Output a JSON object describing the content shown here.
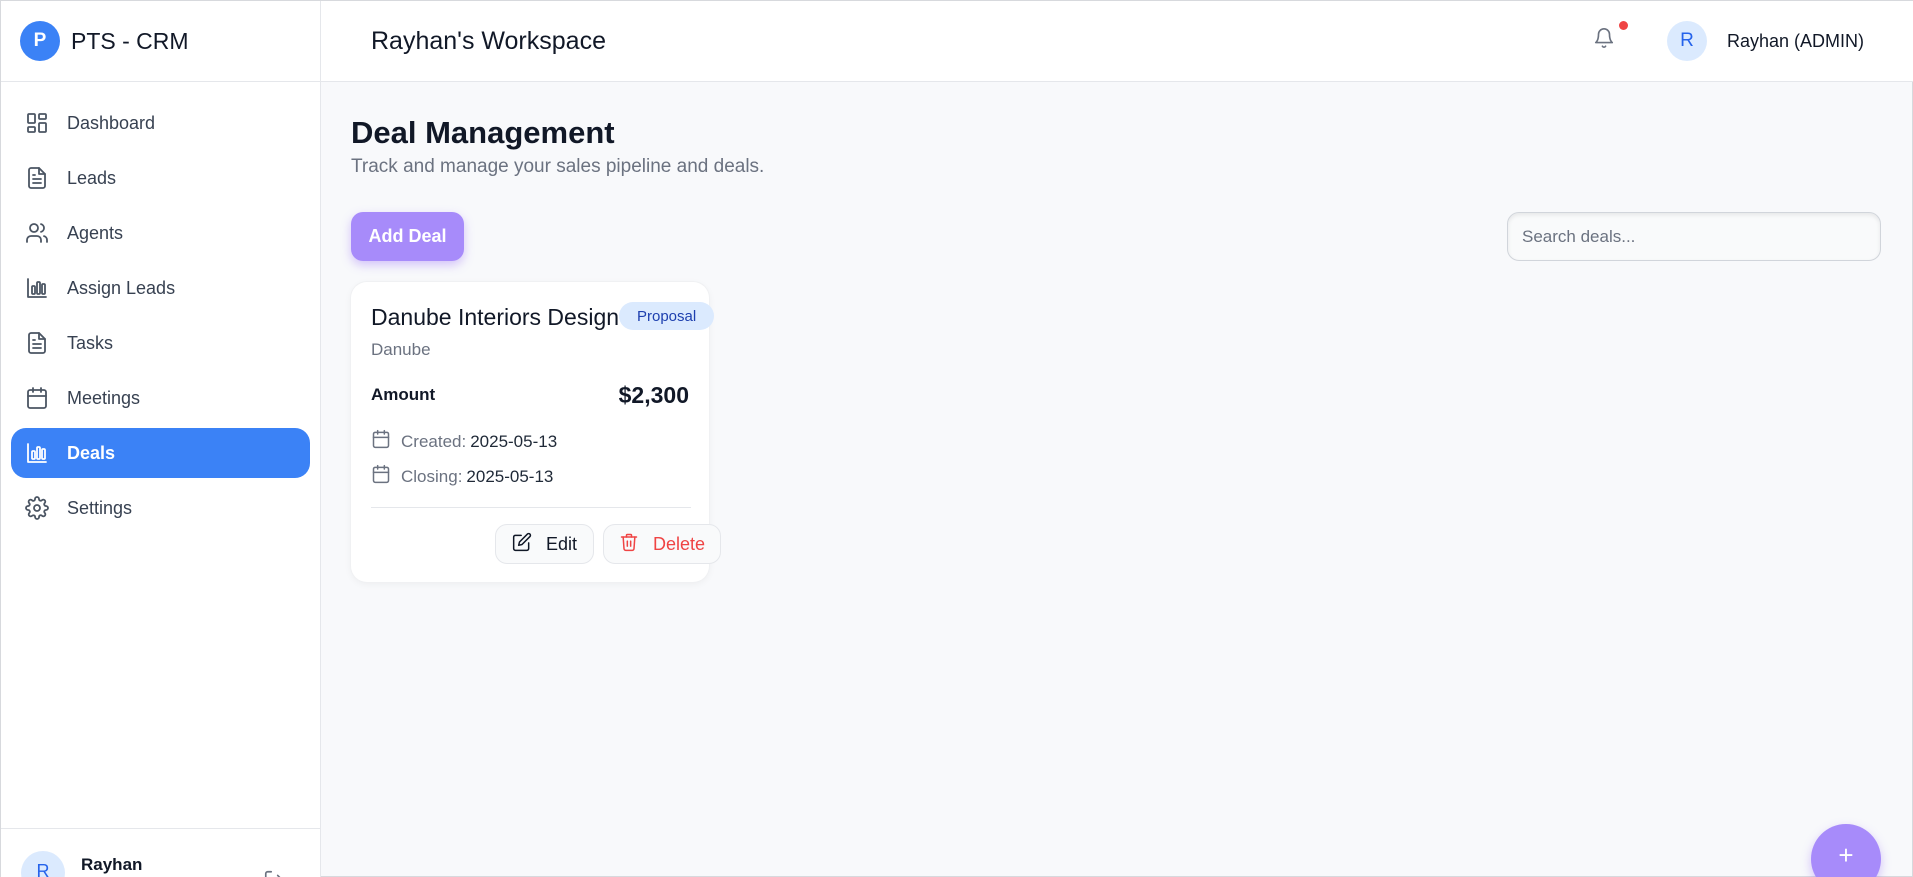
{
  "brand": {
    "logo_letter": "P",
    "name": "PTS - CRM"
  },
  "sidebar": {
    "items": [
      {
        "label": "Dashboard",
        "icon": "dashboard-icon"
      },
      {
        "label": "Leads",
        "icon": "document-icon"
      },
      {
        "label": "Agents",
        "icon": "users-icon"
      },
      {
        "label": "Assign Leads",
        "icon": "bar-chart-icon"
      },
      {
        "label": "Tasks",
        "icon": "document-icon"
      },
      {
        "label": "Meetings",
        "icon": "calendar-icon"
      },
      {
        "label": "Deals",
        "icon": "bar-chart-icon",
        "active": true
      },
      {
        "label": "Settings",
        "icon": "gear-icon"
      }
    ],
    "footer": {
      "avatar_letter": "R",
      "name": "Rayhan"
    }
  },
  "header": {
    "workspace_title": "Rayhan's Workspace",
    "user": {
      "avatar_letter": "R",
      "name": "Rayhan (ADMIN)"
    }
  },
  "page": {
    "title": "Deal Management",
    "subtitle": "Track and manage your sales pipeline and deals.",
    "add_button": "Add Deal",
    "search_placeholder": "Search deals..."
  },
  "deals": [
    {
      "title": "Danube Interiors Design",
      "stage": "Proposal",
      "company": "Danube",
      "amount_label": "Amount",
      "amount": "$2,300",
      "created_label": "Created:",
      "created": "2025-05-13",
      "closing_label": "Closing:",
      "closing": "2025-05-13",
      "edit_label": "Edit",
      "delete_label": "Delete"
    }
  ],
  "fab": {
    "label": "+"
  },
  "colors": {
    "primary": "#3b82f6",
    "accent_purple": "#a78bfa",
    "danger": "#ef4444",
    "badge_bg": "#dbeafe",
    "badge_text": "#1e40af"
  }
}
